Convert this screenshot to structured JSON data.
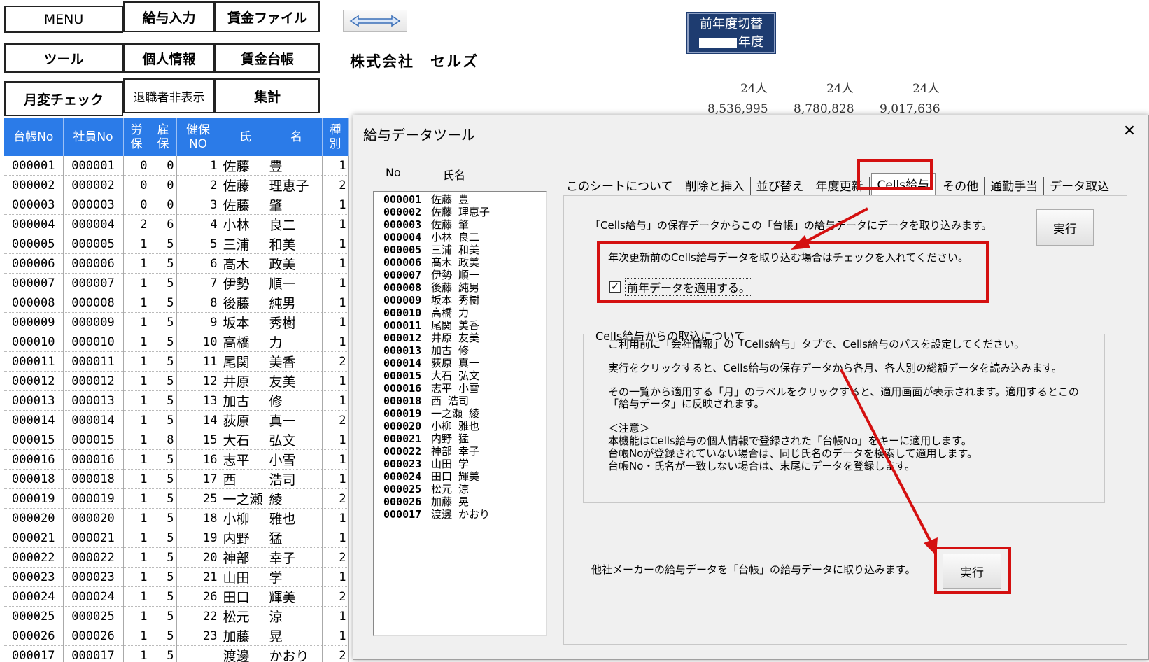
{
  "menu": {
    "menu": "MENU",
    "kyuyo_input": "給与入力",
    "chingin_file": "賃金ファイル",
    "tool": "ツール",
    "kojin": "個人情報",
    "chingin_daicho": "賃金台帳",
    "getsuhen": "月変チェック",
    "taishoku": "退職者非表示",
    "shukei": "集計"
  },
  "company": "株式会社　セルズ",
  "prev_year": {
    "line1": "前年度切替",
    "line2": "年度"
  },
  "summary": {
    "count1": "24人",
    "count2": "24人",
    "count3": "24人",
    "amount1": "8,536,995",
    "amount2": "8,780,828",
    "amount3": "9,017,636"
  },
  "grid": {
    "headers": {
      "daicho": "台帳No",
      "shain": "社員No",
      "rouho_1": "労",
      "rouho_2": "保",
      "koho_1": "雇",
      "koho_2": "保",
      "kenpo_1": "健保",
      "kenpo_2": "NO",
      "shimei_1": "氏",
      "shimei_2": "名",
      "shubetsu_1": "種",
      "shubetsu_2": "別"
    },
    "rows": [
      {
        "d": "000001",
        "s": "000001",
        "r": "0",
        "k": "0",
        "n": "1",
        "f": "佐藤",
        "g": "豊",
        "t": "1"
      },
      {
        "d": "000002",
        "s": "000002",
        "r": "0",
        "k": "0",
        "n": "2",
        "f": "佐藤",
        "g": "理恵子",
        "t": "2"
      },
      {
        "d": "000003",
        "s": "000003",
        "r": "0",
        "k": "0",
        "n": "3",
        "f": "佐藤",
        "g": "肇",
        "t": "1"
      },
      {
        "d": "000004",
        "s": "000004",
        "r": "2",
        "k": "6",
        "n": "4",
        "f": "小林",
        "g": "良二",
        "t": "1"
      },
      {
        "d": "000005",
        "s": "000005",
        "r": "1",
        "k": "5",
        "n": "5",
        "f": "三浦",
        "g": "和美",
        "t": "1"
      },
      {
        "d": "000006",
        "s": "000006",
        "r": "1",
        "k": "5",
        "n": "6",
        "f": "髙木",
        "g": "政美",
        "t": "1"
      },
      {
        "d": "000007",
        "s": "000007",
        "r": "1",
        "k": "5",
        "n": "7",
        "f": "伊勢",
        "g": "順一",
        "t": "1"
      },
      {
        "d": "000008",
        "s": "000008",
        "r": "1",
        "k": "5",
        "n": "8",
        "f": "後藤",
        "g": "純男",
        "t": "1"
      },
      {
        "d": "000009",
        "s": "000009",
        "r": "1",
        "k": "5",
        "n": "9",
        "f": "坂本",
        "g": "秀樹",
        "t": "1"
      },
      {
        "d": "000010",
        "s": "000010",
        "r": "1",
        "k": "5",
        "n": "10",
        "f": "高橋",
        "g": "力",
        "t": "1"
      },
      {
        "d": "000011",
        "s": "000011",
        "r": "1",
        "k": "5",
        "n": "11",
        "f": "尾関",
        "g": "美香",
        "t": "2"
      },
      {
        "d": "000012",
        "s": "000012",
        "r": "1",
        "k": "5",
        "n": "12",
        "f": "井原",
        "g": "友美",
        "t": "1"
      },
      {
        "d": "000013",
        "s": "000013",
        "r": "1",
        "k": "5",
        "n": "13",
        "f": "加古",
        "g": "修",
        "t": "1"
      },
      {
        "d": "000014",
        "s": "000014",
        "r": "1",
        "k": "5",
        "n": "14",
        "f": "荻原",
        "g": "真一",
        "t": "2"
      },
      {
        "d": "000015",
        "s": "000015",
        "r": "1",
        "k": "8",
        "n": "15",
        "f": "大石",
        "g": "弘文",
        "t": "1"
      },
      {
        "d": "000016",
        "s": "000016",
        "r": "1",
        "k": "5",
        "n": "16",
        "f": "志平",
        "g": "小雪",
        "t": "1"
      },
      {
        "d": "000018",
        "s": "000018",
        "r": "1",
        "k": "5",
        "n": "17",
        "f": "西",
        "g": "浩司",
        "t": "1"
      },
      {
        "d": "000019",
        "s": "000019",
        "r": "1",
        "k": "5",
        "n": "25",
        "f": "一之瀬",
        "g": "綾",
        "t": "2"
      },
      {
        "d": "000020",
        "s": "000020",
        "r": "1",
        "k": "5",
        "n": "18",
        "f": "小柳",
        "g": "雅也",
        "t": "1"
      },
      {
        "d": "000021",
        "s": "000021",
        "r": "1",
        "k": "5",
        "n": "19",
        "f": "内野",
        "g": "猛",
        "t": "1"
      },
      {
        "d": "000022",
        "s": "000022",
        "r": "1",
        "k": "5",
        "n": "20",
        "f": "神部",
        "g": "幸子",
        "t": "2"
      },
      {
        "d": "000023",
        "s": "000023",
        "r": "1",
        "k": "5",
        "n": "21",
        "f": "山田",
        "g": "学",
        "t": "1"
      },
      {
        "d": "000024",
        "s": "000024",
        "r": "1",
        "k": "5",
        "n": "26",
        "f": "田口",
        "g": "輝美",
        "t": "2"
      },
      {
        "d": "000025",
        "s": "000025",
        "r": "1",
        "k": "5",
        "n": "22",
        "f": "松元",
        "g": "涼",
        "t": "1"
      },
      {
        "d": "000026",
        "s": "000026",
        "r": "1",
        "k": "5",
        "n": "23",
        "f": "加藤",
        "g": "晃",
        "t": "1"
      },
      {
        "d": "000017",
        "s": "000017",
        "r": "1",
        "k": "5",
        "n": "",
        "f": "渡邊",
        "g": "かおり",
        "t": "2"
      }
    ]
  },
  "dialog": {
    "title": "給与データツール",
    "close": "✕",
    "list_header_no": "No",
    "list_header_name": "氏名",
    "list": [
      {
        "no": "000001",
        "name": "佐藤 豊"
      },
      {
        "no": "000002",
        "name": "佐藤 理恵子"
      },
      {
        "no": "000003",
        "name": "佐藤 肇"
      },
      {
        "no": "000004",
        "name": "小林 良二"
      },
      {
        "no": "000005",
        "name": "三浦 和美"
      },
      {
        "no": "000006",
        "name": "髙木 政美"
      },
      {
        "no": "000007",
        "name": "伊勢 順一"
      },
      {
        "no": "000008",
        "name": "後藤 純男"
      },
      {
        "no": "000009",
        "name": "坂本 秀樹"
      },
      {
        "no": "000010",
        "name": "高橋 力"
      },
      {
        "no": "000011",
        "name": "尾関 美香"
      },
      {
        "no": "000012",
        "name": "井原 友美"
      },
      {
        "no": "000013",
        "name": "加古 修"
      },
      {
        "no": "000014",
        "name": "荻原 真一"
      },
      {
        "no": "000015",
        "name": "大石 弘文"
      },
      {
        "no": "000016",
        "name": "志平 小雪"
      },
      {
        "no": "000018",
        "name": "西 浩司"
      },
      {
        "no": "000019",
        "name": "一之瀬 綾"
      },
      {
        "no": "000020",
        "name": "小柳 雅也"
      },
      {
        "no": "000021",
        "name": "内野 猛"
      },
      {
        "no": "000022",
        "name": "神部 幸子"
      },
      {
        "no": "000023",
        "name": "山田 学"
      },
      {
        "no": "000024",
        "name": "田口 輝美"
      },
      {
        "no": "000025",
        "name": "松元 涼"
      },
      {
        "no": "000026",
        "name": "加藤 晃"
      },
      {
        "no": "000017",
        "name": "渡邊 かおり"
      }
    ],
    "tabs": [
      "このシートについて",
      "削除と挿入",
      "並び替え",
      "年度更新",
      "Cells給与",
      "その他",
      "通勤手当",
      "データ取込"
    ],
    "panel": {
      "intro": "「Cells給与」の保存データからこの「台帳」の給与データにデータを取り込みます。",
      "exec1": "実行",
      "note": "年次更新前のCells給与データを取り込む場合はチェックを入れてください。",
      "checkbox_label": "前年データを適用する。",
      "checkbox_mark": "✓",
      "group_title": "Cells給与からの取込について",
      "g1": "ご利用前に「会社情報」の「Cells給与」タブで、Cells給与のパスを設定してください。",
      "g2": "実行をクリックすると、Cells給与の保存データから各月、各人別の総額データを読み込みます。",
      "g3a": "その一覧から適用する「月」のラベルをクリックすると、適用画面が表示されます。適用するとこの",
      "g3b": "「給与データ」に反映されます。",
      "g4": "＜注意＞",
      "g5": "本機能はCells給与の個人情報で登録された「台帳No」をキーに適用します。",
      "g6": "台帳Noが登録されていない場合は、同じ氏名のデータを検索して適用します。",
      "g7": "台帳No・氏名が一致しない場合は、末尾にデータを登録します。",
      "other": "他社メーカーの給与データを「台帳」の給与データに取り込みます。",
      "exec2": "実行"
    }
  }
}
